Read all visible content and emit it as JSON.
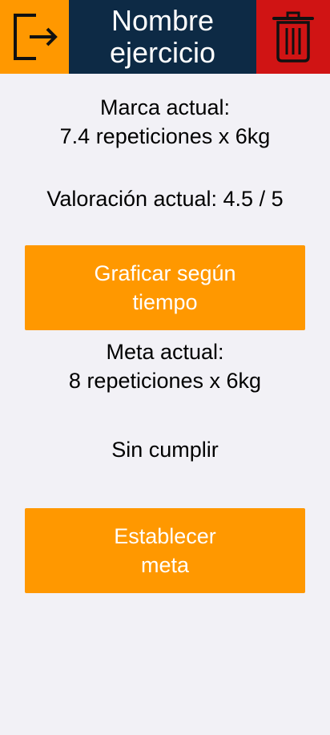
{
  "header": {
    "title": "Nombre\nejercicio",
    "exit_icon": "exit-icon",
    "delete_icon": "trash-icon"
  },
  "current_mark": {
    "label": "Marca actual:\n7.4 repeticiones x 6kg"
  },
  "current_rating": {
    "label": "Valoración actual: 4.5 / 5"
  },
  "graph_button": {
    "label": "Graficar según\ntiempo"
  },
  "current_goal": {
    "label": "Meta actual:\n8 repeticiones x 6kg"
  },
  "goal_status": {
    "label": "Sin cumplir"
  },
  "set_goal_button": {
    "label": "Establecer\nmeta"
  },
  "colors": {
    "accent": "#ff9800",
    "header_title_bg": "#0d2a45",
    "delete_bg": "#d01414",
    "background": "#f2f1f6"
  }
}
